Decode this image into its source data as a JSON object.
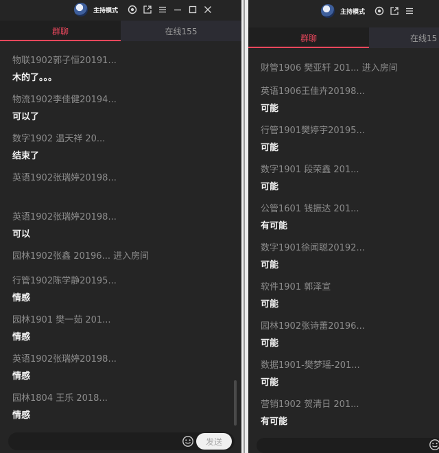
{
  "left": {
    "titlebar": {
      "mode_label": "主持模式",
      "icons": [
        "avatar-icon",
        "target-icon",
        "popout-icon",
        "menu-icon",
        "minimize-icon",
        "maximize-icon",
        "close-icon"
      ]
    },
    "tabs": [
      {
        "label": "群聊",
        "active": true
      },
      {
        "label": "在线155",
        "active": false
      }
    ],
    "messages": [
      {
        "sender": "物联1902郭子恒20191...",
        "content": "木的了。。。"
      },
      {
        "sender": "物流1902李佳健20194...",
        "content": "可以了"
      },
      {
        "sender": "数字1902 温天祥  20...",
        "content": "结束了"
      },
      {
        "sender": "英语1902张瑞婷20198...",
        "content": ""
      },
      {
        "sender": "英语1902张瑞婷20198...",
        "content": "可以"
      },
      {
        "sender": "园林1902张鑫 20196... 进入房间",
        "content": ""
      },
      {
        "sender": "行管1902陈学静20195...",
        "content": "情感"
      },
      {
        "sender": "园林1901 樊一茹 201...",
        "content": "情感"
      },
      {
        "sender": "英语1902张瑞婷20198...",
        "content": "情感"
      },
      {
        "sender": "园林1804 王乐 2018...",
        "content": "情感"
      }
    ],
    "composer": {
      "send_label": "发送"
    }
  },
  "right": {
    "titlebar": {
      "mode_label": "主持模式",
      "icons": [
        "avatar-icon",
        "target-icon",
        "popout-icon",
        "menu-icon"
      ]
    },
    "tabs": [
      {
        "label": "群聊",
        "active": true
      },
      {
        "label": "在线15",
        "active": false
      }
    ],
    "messages": [
      {
        "sender": "财管1906 樊亚轩 201... 进入房间",
        "content": ""
      },
      {
        "sender": "英语1906王佳卉20198...",
        "content": "可能"
      },
      {
        "sender": "行管1901樊婷宇20195...",
        "content": "可能"
      },
      {
        "sender": "数字1901 段荣鑫 201...",
        "content": "可能"
      },
      {
        "sender": "公管1601 钱振达 201...",
        "content": "有可能"
      },
      {
        "sender": "数字1901徐闻聪20192...",
        "content": "可能"
      },
      {
        "sender": "软件1901  郭泽宣",
        "content": "可能"
      },
      {
        "sender": "园林1902张诗蕾20196...",
        "content": "可能"
      },
      {
        "sender": "数据1901-樊梦瑶-201...",
        "content": "可能"
      },
      {
        "sender": "营销1902 贺清日 201...",
        "content": "有可能"
      }
    ]
  },
  "colors": {
    "accent": "#e9475c",
    "panel_bg": "#252525",
    "tab_bar_bg": "#1b1b1b",
    "sender_text": "#8c8c8c",
    "content_text": "#f2f2f2"
  }
}
